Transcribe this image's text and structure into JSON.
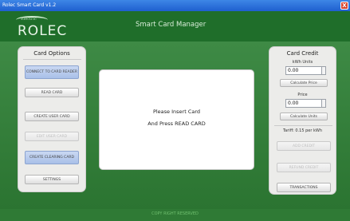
{
  "window": {
    "title": "Rolec Smart Card v1.2",
    "close_label": "X"
  },
  "header": {
    "logo_text": "ROLEC",
    "logo_small": "Electric",
    "title": "Smart Card Manager"
  },
  "left": {
    "title": "Card Options",
    "buttons": [
      {
        "label": "CONNECT TO CARD READER",
        "style": "blue"
      },
      {
        "label": "READ CARD",
        "style": "normal"
      },
      {
        "label": "CREATE USER CARD",
        "style": "normal"
      },
      {
        "label": "EDIT USER CARD",
        "style": "disabled"
      },
      {
        "label": "CREATE CLEARING CARD",
        "style": "blue"
      },
      {
        "label": "SETTINGS",
        "style": "normal"
      }
    ]
  },
  "center": {
    "line1": "Please Insert Card",
    "line2": "And Press READ CARD"
  },
  "right": {
    "title": "Card Credit",
    "kwh_label": "kWh Units",
    "kwh_value": "0.00",
    "calc_price": "Calculate Price",
    "price_label": "Price",
    "price_value": "0.00",
    "calc_units": "Calculate Units",
    "tariff": "Tariff: 0.15 per kWh",
    "add_credit": "ADD CREDIT",
    "refund_credit": "REFUND CREDIT",
    "transactions": "TRANSACTIONS"
  },
  "footer": {
    "text": "COPY RIGHT RESERVED"
  }
}
